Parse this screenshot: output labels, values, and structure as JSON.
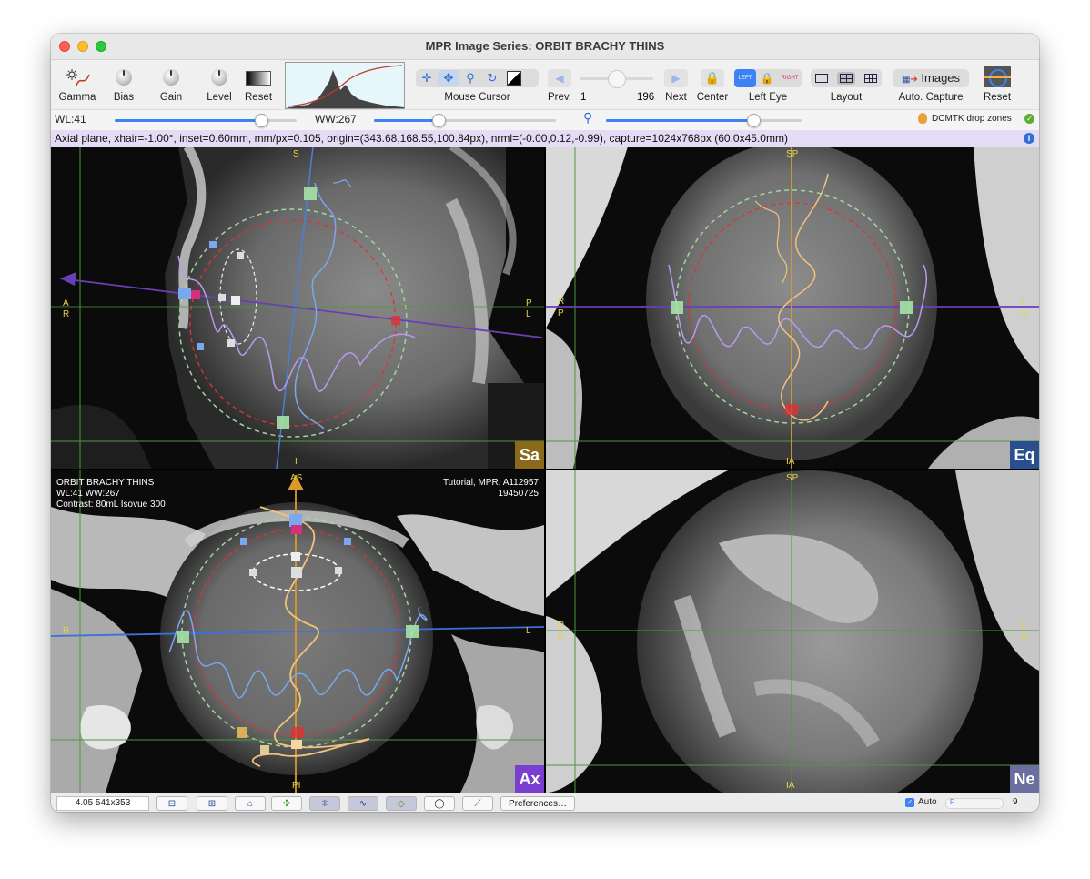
{
  "window": {
    "title": "MPR Image Series: ORBIT BRACHY THINS"
  },
  "toolbar": {
    "gamma": "Gamma",
    "bias": "Bias",
    "gain": "Gain",
    "level": "Level",
    "reset_lut": "Reset",
    "mouse_cursor": "Mouse Cursor",
    "prev": "Prev.",
    "slice_min": "1",
    "slice_max": "196",
    "next": "Next",
    "center": "Center",
    "left_eye": "Left Eye",
    "eye_left_tag": "LEFT",
    "eye_right_tag": "RIGHT",
    "layout": "Layout",
    "auto_capture_btn": "Images",
    "auto_capture": "Auto. Capture",
    "reset_view": "Reset"
  },
  "sliders": {
    "wl_label": "WL:41",
    "wl_level": 0.8,
    "ww_label": "WW:267",
    "ww_level": 0.35,
    "zoom_level": 0.75,
    "dcmtk": "DCMTK drop zones"
  },
  "info": {
    "text": "Axial plane, xhair=-1.00°, inset=0.60mm, mm/px=0.105, origin=(343.68,168.55,100.84px), nrml=(-0.00,0.12,-0.99), capture=1024x768px (60.0x45.0mm)"
  },
  "viewports": {
    "sa": {
      "badge": "Sa",
      "top": "S",
      "bottom": "I",
      "left1": "A",
      "left2": "R",
      "right1": "P",
      "right2": "L"
    },
    "eq": {
      "badge": "Eq",
      "top": "SP",
      "bottom": "IA",
      "left1": "R",
      "left2": "P",
      "right1": "L",
      "right2": "A"
    },
    "ax": {
      "badge": "Ax",
      "top": "AS",
      "bottom": "PI",
      "left": "R",
      "right": "L",
      "overlay_left": [
        "ORBIT BRACHY THINS",
        "WL:41  WW:267",
        "Contrast: 80mL Isovue 300"
      ],
      "overlay_right": [
        "Tutorial, MPR, A112957",
        "19450725"
      ]
    },
    "ne": {
      "badge": "Ne",
      "top": "SP",
      "bottom": "IA",
      "left1": "R",
      "left2": "P",
      "right1": "L",
      "right2": "A"
    }
  },
  "status": {
    "zoom_info": "4.05 541x353",
    "preferences": "Preferences…",
    "auto_label": "Auto",
    "auto_checked": true,
    "frame_label": "F",
    "frame_value": "9"
  },
  "colors": {
    "badge_sa": "#8a6a1a",
    "badge_eq": "#2a4f8f",
    "badge_ax": "#7a3fd0",
    "badge_ne": "#6a6fa0",
    "info_bg": "#e4dcf5",
    "accent": "#3b82f6"
  }
}
